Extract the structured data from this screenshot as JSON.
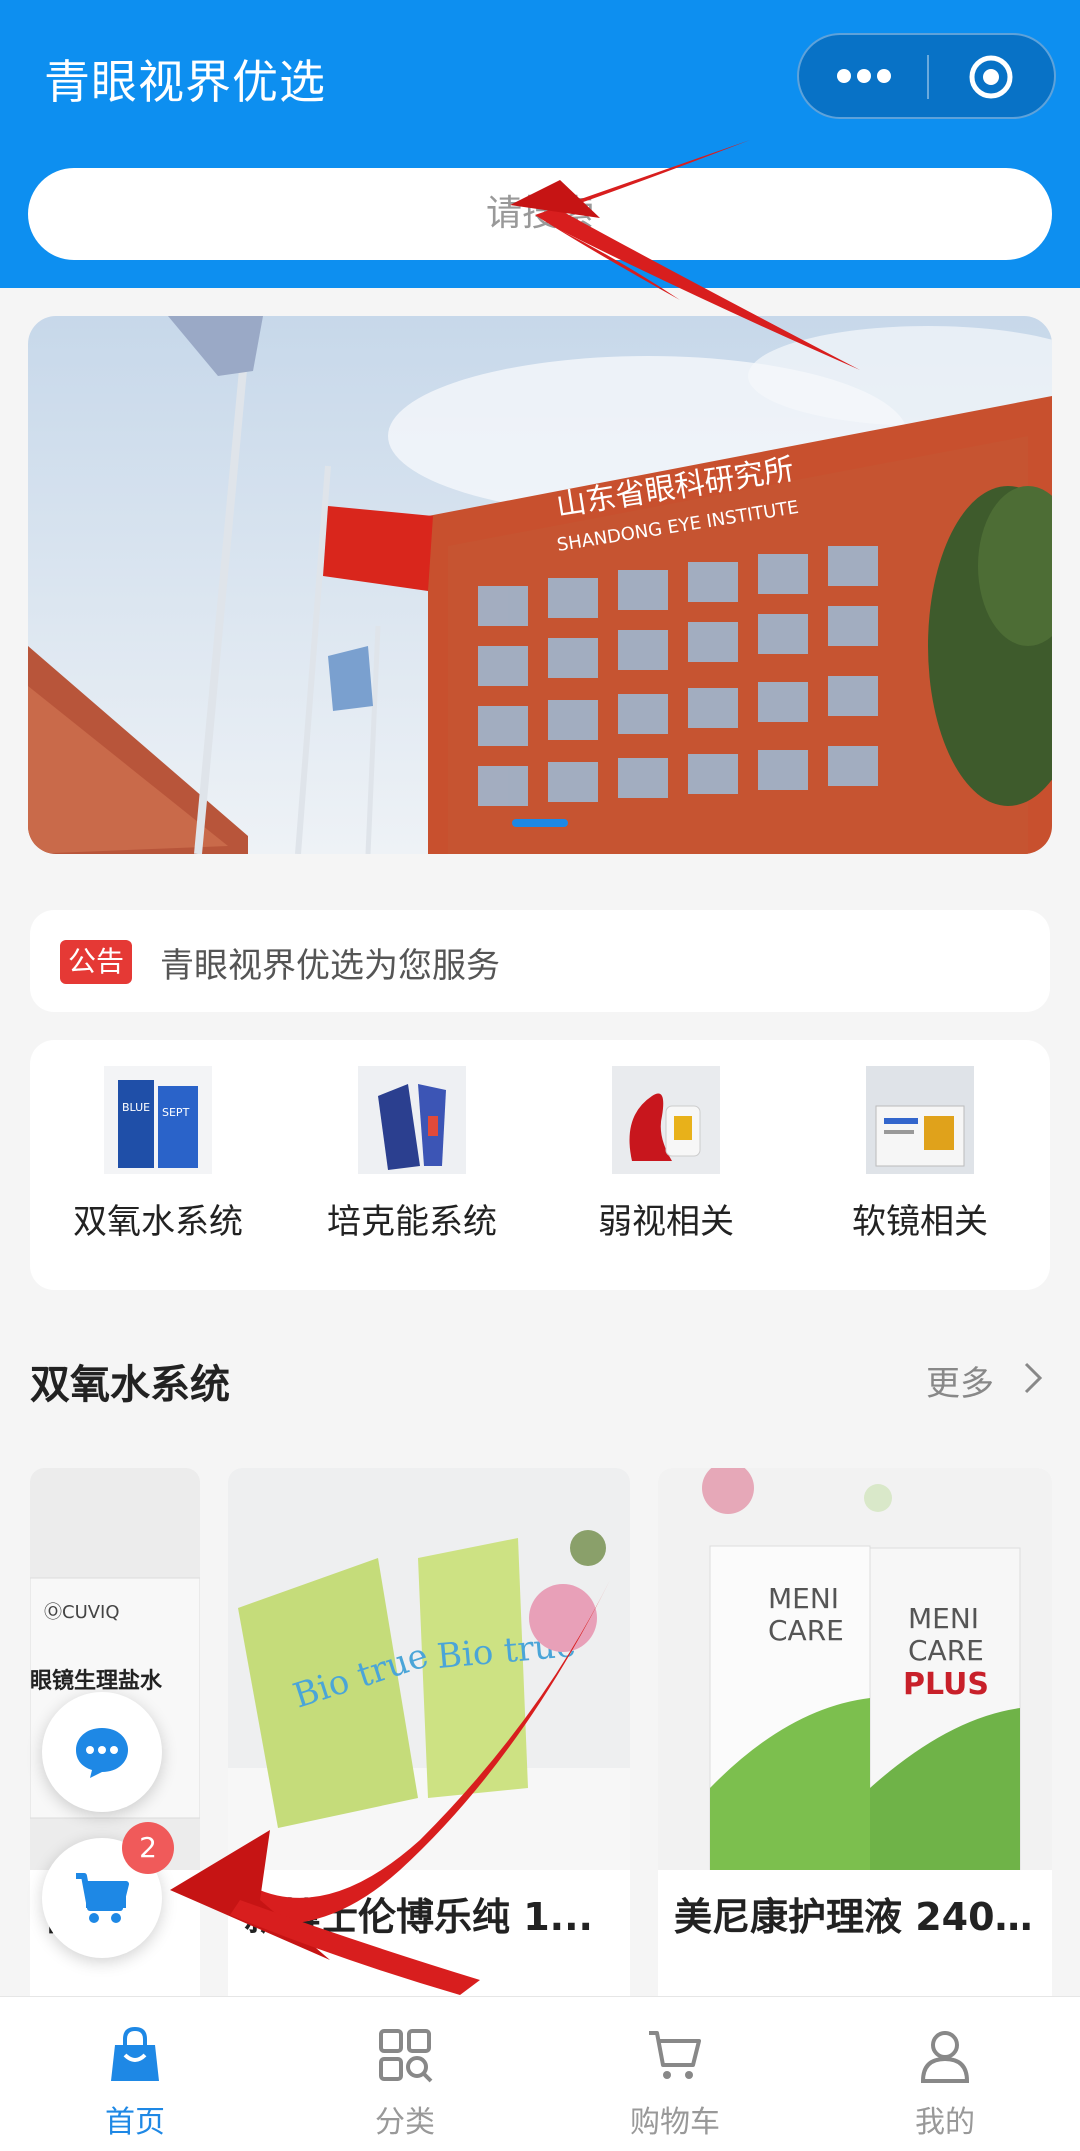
{
  "header": {
    "title": "青眼视界优选",
    "menu_icon": "more-dots-icon",
    "capsule_icon": "target-icon",
    "search_placeholder": "请搜索",
    "background_color": "#0d8ff0"
  },
  "banner": {
    "sign_cn": "山东省眼科研究所",
    "sign_en": "SHANDONG EYE INSTITUTE"
  },
  "notice": {
    "badge": "公告",
    "text": "青眼视界优选为您服务"
  },
  "categories": [
    {
      "label": "双氧水系统"
    },
    {
      "label": "培克能系统"
    },
    {
      "label": "弱视相关"
    },
    {
      "label": "软镜相关"
    }
  ],
  "section": {
    "title": "双氧水系统",
    "more": "更多"
  },
  "products": [
    {
      "title": "舒...",
      "image_text": "ⓄCUVIQ 视倍佳 眼镜生理盐水"
    },
    {
      "title": "新博士伦博乐纯 1...",
      "image_text": "Bio true"
    },
    {
      "title": "美尼康护理液 240...",
      "image_text": "MENI CARE PLUS"
    }
  ],
  "floating": {
    "chat_icon": "chat-bubble-icon",
    "cart_icon": "cart-icon",
    "cart_count": "2"
  },
  "tabbar": {
    "items": [
      {
        "label": "首页",
        "icon": "shopping-bag-icon",
        "active": true
      },
      {
        "label": "分类",
        "icon": "category-grid-icon",
        "active": false
      },
      {
        "label": "购物车",
        "icon": "cart-icon",
        "active": false
      },
      {
        "label": "我的",
        "icon": "user-icon",
        "active": false
      }
    ],
    "active_color": "#1e88e5",
    "inactive_color": "#999999"
  }
}
